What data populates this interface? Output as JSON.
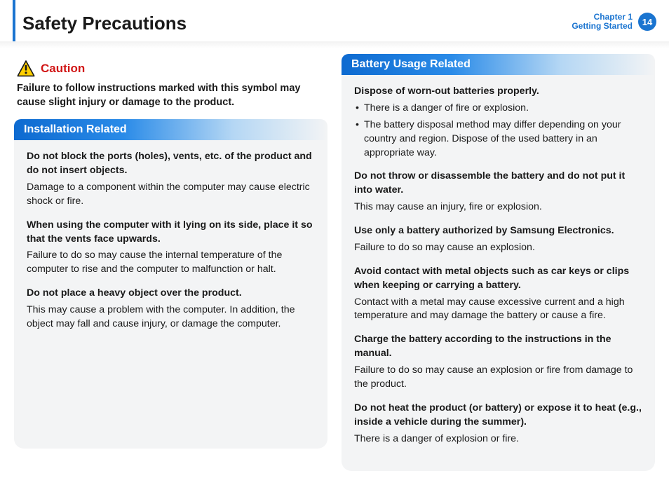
{
  "header": {
    "title": "Safety Precautions",
    "chapter_line1": "Chapter 1",
    "chapter_line2": "Getting Started",
    "page_number": "14"
  },
  "caution": {
    "label": "Caution",
    "text": "Failure to follow instructions marked with this symbol may cause slight injury or damage to the product."
  },
  "left": {
    "heading": "Installation Related",
    "items": [
      {
        "strong": "Do not block the ports (holes), vents, etc. of the product and do not insert objects.",
        "body": "Damage to a component within the computer may cause electric shock or fire."
      },
      {
        "strong": "When using the computer with it lying on its side, place it so that the vents face upwards.",
        "body": "Failure to do so may cause the internal temperature of the computer to rise and the computer to malfunction or halt."
      },
      {
        "strong": "Do not place a heavy object over the product.",
        "body": "This may cause a problem with the computer. In addition, the object may fall and cause injury, or damage the computer."
      }
    ]
  },
  "right": {
    "heading": "Battery Usage Related",
    "items": [
      {
        "strong": "Dispose of worn-out batteries properly.",
        "bullets": [
          "There is a danger of fire or explosion.",
          "The battery disposal method may differ depending on your country and region. Dispose of the used battery in an appropriate way."
        ]
      },
      {
        "strong": "Do not throw or disassemble the battery and do not put it into water.",
        "body": "This may cause an injury, fire or explosion."
      },
      {
        "strong": "Use only a battery authorized by Samsung Electronics.",
        "body": "Failure to do so may cause an explosion."
      },
      {
        "strong": "Avoid contact with metal objects such as car keys or clips when keeping or carrying a battery.",
        "body": "Contact with a metal may cause excessive current and a high temperature and may damage the battery or cause a fire."
      },
      {
        "strong": "Charge the battery according to the instructions in the manual.",
        "body": "Failure to do so may cause an explosion or fire from damage to the product."
      },
      {
        "strong": "Do not heat the product (or battery) or expose it to heat (e.g., inside a vehicle during the summer).",
        "body": "There is a danger of explosion or fire."
      }
    ]
  }
}
